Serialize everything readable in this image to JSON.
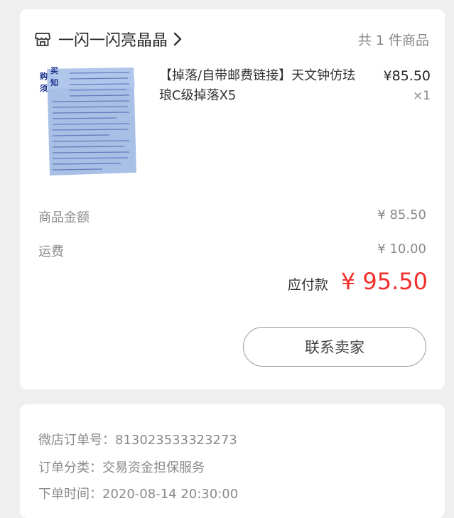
{
  "shop": {
    "name": "一闪一闪亮晶晶",
    "item_count": "共 1 件商品",
    "icon": "store-icon"
  },
  "product": {
    "title": "【掉落/自带邮费链接】天文钟仿珐琅C级掉落X5",
    "price": "¥85.50",
    "quantity": "×1",
    "thumbnail": {
      "heading_left": "购 须",
      "heading_right": "买 知"
    }
  },
  "summary": {
    "goods_label": "商品金额",
    "goods_value": "¥ 85.50",
    "shipping_label": "运费",
    "shipping_value": "¥ 10.00",
    "payable_label": "应付款",
    "payable_value": "¥ 95.50"
  },
  "actions": {
    "contact_label": "联系卖家"
  },
  "order_info": {
    "order_no": "微店订单号：813023533323273",
    "category": "订单分类：交易资金担保服务",
    "order_time": "下单时间：2020-08-14 20:30:00"
  },
  "colors": {
    "accent": "#f0302b",
    "background": "#efefef",
    "card": "#ffffff",
    "thumbnail_bg": "#a8bfe6",
    "thumbnail_heading": "#1a2f8a"
  }
}
